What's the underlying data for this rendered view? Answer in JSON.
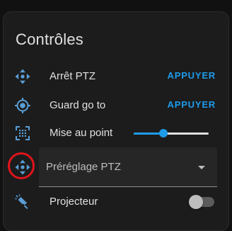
{
  "card": {
    "title": "Contrôles"
  },
  "rows": [
    {
      "label": "Arrêt PTZ",
      "action": "APPUYER",
      "icon": "move-arrows-icon"
    },
    {
      "label": "Guard go to",
      "action": "APPUYER",
      "icon": "crosshair-icon"
    },
    {
      "label": "Mise au point",
      "icon": "focus-frame-icon",
      "slider_value": 0.4
    },
    {
      "select_value": "Préréglage PTZ",
      "icon": "move-arrows-icon"
    },
    {
      "label": "Projecteur",
      "icon": "spotlight-icon",
      "toggle_on": false
    }
  ],
  "colors": {
    "accent": "#1e9be9",
    "highlight": "#e0141b",
    "icon": "#5a9ed6",
    "card_background": "#1c1c1c"
  }
}
